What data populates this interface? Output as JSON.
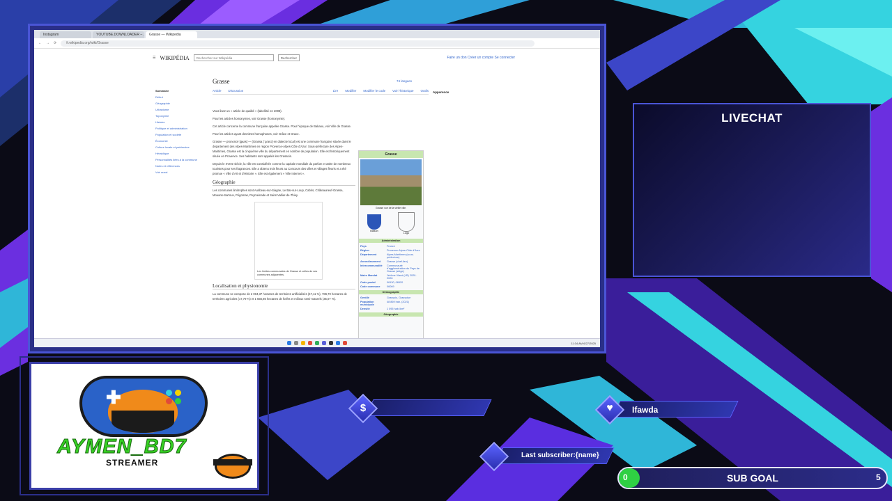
{
  "browser": {
    "tabs": [
      "Instagram",
      "YOUTUBE.DOWNLOADER – ...",
      "Grasse — Wikipedia"
    ],
    "url": "fr.wikipedia.org/wiki/Grasse"
  },
  "wikipedia": {
    "logo": "WIKIPÉDIA",
    "search_placeholder": "Rechercher sur Wikipédia",
    "search_button": "Rechercher",
    "account_links": "Faire un don  Créer un compte  Se connecter",
    "page_title": "Grasse",
    "languages": "74 langues",
    "subtabs": [
      "Article",
      "Discussion",
      "Lire",
      "Modifier",
      "Modifier le code",
      "Voir l'historique",
      "Outils"
    ],
    "appearance": "Apparence",
    "toc_title": "Sommaire",
    "toc_items": [
      "Début",
      "Géographie",
      "Urbanisme",
      "Toponymie",
      "Histoire",
      "Politique et administration",
      "Population et société",
      "Économie",
      "Culture locale et patrimoine",
      "Héraldique",
      "Personnalités liées à la commune",
      "Notes et références",
      "Voir aussi"
    ],
    "hatnotes": [
      "Vous lisez un « article de qualité » (labellisé en 2008).",
      "Pour les articles homonymes, voir Grasse (homonymie).",
      "Cet article concerne la commune française appelée Grasse. Pour l'époque de Bakaou, voir Ville de Grasse.",
      "Pour les articles ayant des titres homophones, voir Grâce et Grace."
    ],
    "intro_1": "Grasse — prononcé [gʁas] — (Grassa [ˈgɾasɔ] en dialecte local) est une commune française située dans le département des Alpes-Maritimes en région Provence-Alpes-Côte d'Azur. Sous-préfecture des Alpes-Maritimes, Grasse est la cinquième ville du département en nombre de population. Elle est historiquement située en Provence. Ses habitants sont appelés les Grassois.",
    "intro_2": "Depuis le XVIIIe siècle, la ville est considérée comme la capitale mondiale du parfum et attire de nombreux touristes pour ses fragrances. Elle a obtenu trois fleurs au Concours des villes et villages fleuris et a été promue « Ville d'Art et d'Histoire ». Elle est également « Ville Internet ».",
    "section_geo": "Géographie",
    "geo_text": "Les communes limitrophes sont Auribeau-sur-Siagne, Le Bar-sur-Loup, Cabris, Châteauneuf-Grasse, Mouans-Sartoux, Pégomas, Peymeinade et Saint-Vallier-de-Thiey.",
    "map_caption": "Les limites communales de Grasse et celles de ses communes adjacentes.",
    "section_loc": "Localisation et physionomie",
    "loc_text": "La commune se compose de 2 004,37 hectares de territoires artificialisés (47,11 %), 786,70 hectares de territoires agricoles (17,79 %) et 1 556,86 hectares de forêts et milieux semi-naturels (35,07 %).",
    "infobox": {
      "title": "Grasse",
      "caption": "Grasse vue de la vieille ville.",
      "crest_label_1": "Blason",
      "crest_label_2": "Logo",
      "band_admin": "Administration",
      "rows": [
        {
          "k": "Pays",
          "v": "France"
        },
        {
          "k": "Région",
          "v": "Provence-Alpes-Côte d'Azur"
        },
        {
          "k": "Département",
          "v": "Alpes-Maritimes (sous-préfecture)"
        },
        {
          "k": "Arrondissement",
          "v": "Grasse (chef-lieu)"
        },
        {
          "k": "Intercommunalité",
          "v": "Communauté d'agglomération du Pays de Grasse (siège)"
        },
        {
          "k": "Maire Mandat",
          "v": "Jérôme Viaud (LR) 2020-2026"
        },
        {
          "k": "Code postal",
          "v": "06130, 06520"
        },
        {
          "k": "Code commune",
          "v": "06069"
        }
      ],
      "band_demo": "Démographie",
      "demo_rows": [
        {
          "k": "Gentilé",
          "v": "Grassois, Grassoise"
        },
        {
          "k": "Population municipale",
          "v": "48 869 hab. (2021)"
        },
        {
          "k": "Densité",
          "v": "1 095 hab./km²"
        }
      ],
      "band_geo": "Géographie"
    },
    "clock": "11:34 AM 6/27/2025"
  },
  "overlay": {
    "livechat_title": "LIVECHAT",
    "streamer_name": "AYMEN_BD7",
    "streamer_sub": "STREAMER",
    "donation_icon": "$",
    "follower_name": "Ifawda",
    "last_subscriber": "Last subscriber:{name}",
    "sub_goal_label": "SUB GOAL",
    "sub_goal_current": "0",
    "sub_goal_max": "5",
    "sub_goal_progress": 0
  },
  "colors": {
    "accent_purple": "#4a55d6",
    "accent_cyan": "#35d3e0",
    "goal_green": "#2fd043",
    "logo_green": "#37d024"
  }
}
